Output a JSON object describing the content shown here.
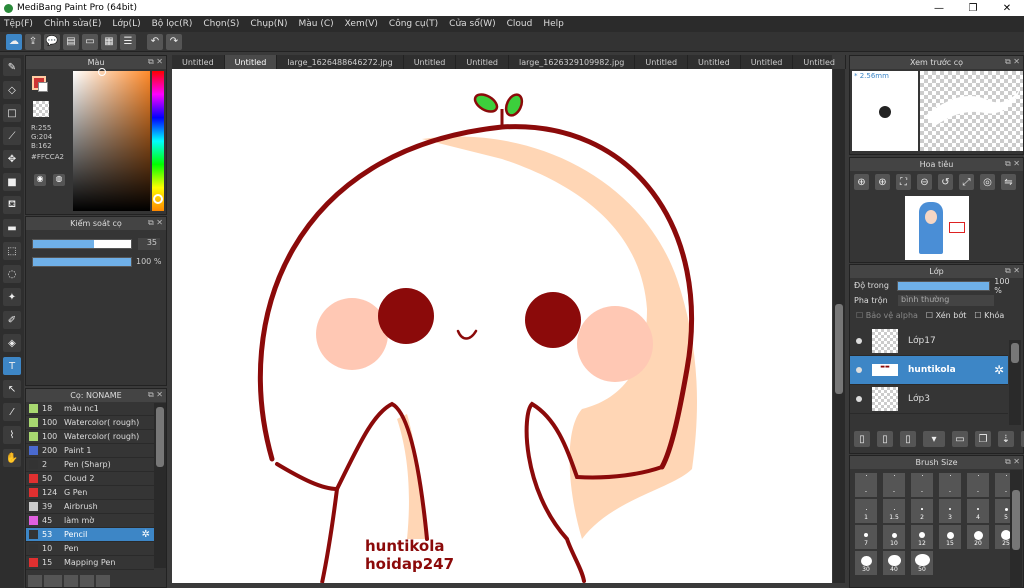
{
  "title": "MediBang Paint Pro (64bit)",
  "menu": [
    "Tệp(F)",
    "Chỉnh sửa(E)",
    "Lớp(L)",
    "Bộ lọc(R)",
    "Chọn(S)",
    "Chụp(N)",
    "Màu (C)",
    "Xem(V)",
    "Công cụ(T)",
    "Cửa sổ(W)",
    "Cloud",
    "Help"
  ],
  "tabs": [
    "Untitled",
    "Untitled",
    "large_1626488646272.jpg",
    "Untitled",
    "Untitled",
    "large_1626329109982.jpg",
    "Untitled",
    "Untitled",
    "Untitled",
    "Untitled"
  ],
  "color_panel": {
    "title": "Màu",
    "r": "R:255",
    "g": "G:204",
    "b": "B:162",
    "hex": "#FFCCA2",
    "fg_color": "#ffcca2"
  },
  "brush_control": {
    "title": "Kiểm soát cọ",
    "size_value": "35",
    "size_fill": 0.62,
    "opacity_value": "100 %",
    "opacity_fill": 1.0
  },
  "brush_list": {
    "title": "Cọ: NONAME",
    "items": [
      {
        "num": "18",
        "name": "màu nc1",
        "color": "#a8d870"
      },
      {
        "num": "100",
        "name": "Watercolor( rough)",
        "color": "#a8d870"
      },
      {
        "num": "100",
        "name": "Watercolor( rough)",
        "color": "#a8d870"
      },
      {
        "num": "200",
        "name": "Paint 1",
        "color": "#4a6ad0"
      },
      {
        "num": "2",
        "name": "Pen (Sharp)",
        "color": "#333333"
      },
      {
        "num": "50",
        "name": "Cloud 2",
        "color": "#e03030"
      },
      {
        "num": "124",
        "name": "G Pen",
        "color": "#e03030"
      },
      {
        "num": "39",
        "name": "Airbrush",
        "color": "#cccccc"
      },
      {
        "num": "45",
        "name": "làm mờ",
        "color": "#e060e0"
      },
      {
        "num": "53",
        "name": "Pencil",
        "color": "#333333"
      },
      {
        "num": "10",
        "name": "Pen",
        "color": "#333333"
      },
      {
        "num": "15",
        "name": "Mapping Pen",
        "color": "#e03030"
      }
    ],
    "selected_index": 9
  },
  "preview_panel": {
    "title": "Xem trước cọ",
    "size_label": "* 2.56mm"
  },
  "navigator_panel": {
    "title": "Hoa tiêu"
  },
  "layer_panel": {
    "title": "Lớp",
    "opacity_label": "Độ trong",
    "opacity_value": "100 %",
    "blend_label": "Pha trộn",
    "blend_value": "bình thường",
    "protect_alpha": "Bảo vệ alpha",
    "clipping": "Xén bớt",
    "lock": "Khóa",
    "layers": [
      {
        "name": "Lớp17",
        "selected": false
      },
      {
        "name": "huntikola",
        "selected": true
      },
      {
        "name": "Lớp3",
        "selected": false
      }
    ]
  },
  "brush_size_panel": {
    "title": "Brush Size",
    "sizes": [
      "1",
      "1.5",
      "2",
      "3",
      "4",
      "5",
      "7",
      "10",
      "12",
      "15",
      "20",
      "25",
      "30",
      "40",
      "50"
    ]
  },
  "canvas": {
    "watermark_line1": "huntikola",
    "watermark_line2": "hoidap247"
  }
}
